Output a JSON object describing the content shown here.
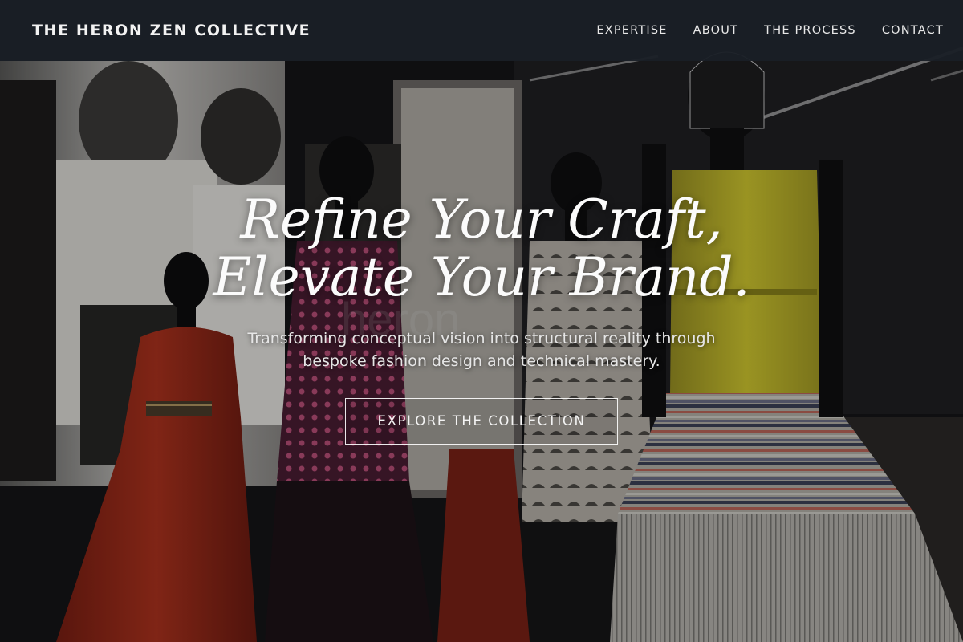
{
  "header": {
    "brand": "THE HERON ZEN COLLECTIVE",
    "nav": [
      {
        "label": "EXPERTISE"
      },
      {
        "label": "ABOUT"
      },
      {
        "label": "THE PROCESS"
      },
      {
        "label": "CONTACT"
      }
    ]
  },
  "hero": {
    "headline_line1": "Refine Your Craft,",
    "headline_line2": "Elevate Your Brand.",
    "subtitle": "Transforming conceptual vision into structural reality through bespoke fashion design and technical mastery.",
    "cta_label": "EXPLORE THE COLLECTION"
  },
  "background": {
    "watermark": "heron",
    "colors": {
      "red_dress": "#a82a16",
      "yellow_dress": "#c9bf26",
      "header_bg": "#1a1f27"
    }
  }
}
